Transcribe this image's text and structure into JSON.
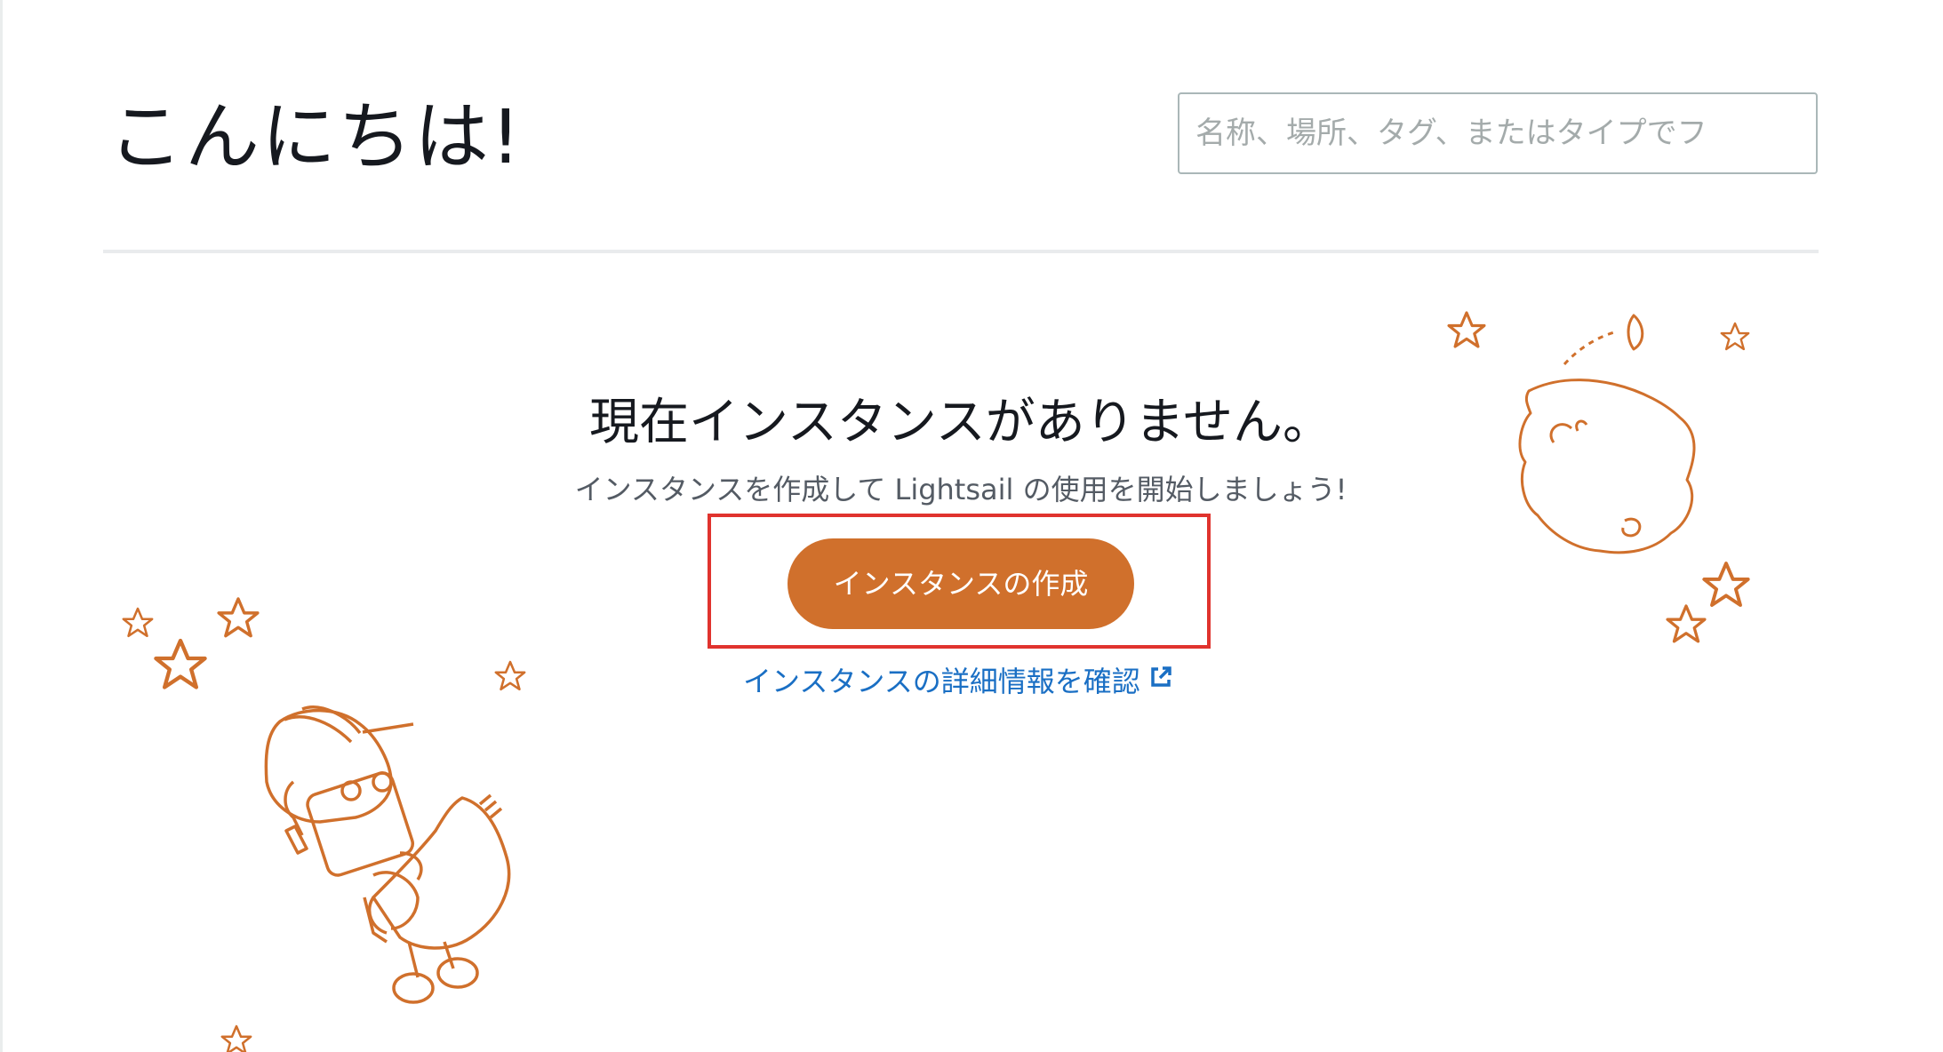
{
  "header": {
    "greeting": "こんにちは!",
    "search_placeholder": "名称、場所、タグ、またはタイプでフ"
  },
  "empty_state": {
    "title": "現在インスタンスがありません。",
    "subtitle": "インスタンスを作成して Lightsail の使用を開始しましょう!",
    "create_button_label": "インスタンスの作成",
    "learn_more_link": "インスタンスの詳細情報を確認"
  },
  "colors": {
    "accent": "#d0702c",
    "link": "#1a6fc4",
    "highlight": "#e0332e"
  },
  "icons": [
    "external-link-icon",
    "star-icon",
    "robot-illustration",
    "moon-illustration"
  ]
}
